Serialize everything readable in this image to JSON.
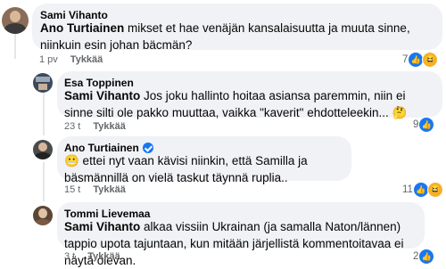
{
  "comments": [
    {
      "author": "Sami Vihanto",
      "mention": "Ano Turtiainen",
      "text": " mikset et hae venäjän kansalaisuutta ja muuta sinne, niinkuin esin johan bäcmän?",
      "time": "1 pv",
      "like_label": "Tykkää",
      "react_count": "7",
      "reactions": [
        "like",
        "haha"
      ],
      "verified": false
    },
    {
      "author": "Esa Toppinen",
      "mention": "Sami Vihanto",
      "text": " Jos joku hallinto hoitaa asiansa paremmin, niin ei sinne silti ole pakko muuttaa, vaikka \"kaverit\" ehdotteleekin... 🤔",
      "time": "23 t",
      "like_label": "Tykkää",
      "react_count": "9",
      "reactions": [
        "like"
      ],
      "verified": false
    },
    {
      "author": "Ano Turtiainen",
      "mention": "",
      "text": "😬 ettei nyt vaan kävisi niinkin, että Samilla ja bäsmännillä on vielä taskut täynnä ruplia..",
      "time": "15 t",
      "like_label": "Tykkää",
      "react_count": "11",
      "reactions": [
        "like",
        "haha"
      ],
      "verified": true
    },
    {
      "author": "Tommi Lievemaa",
      "mention": "Sami Vihanto",
      "text": " alkaa vissiin Ukrainan (ja samalla Naton/lännen) tappio upota tajuntaan, kun mitään järjellistä kommentoitavaa ei näytä olevan.",
      "time": "3 t",
      "like_label": "Tykkää",
      "react_count": "2",
      "reactions": [
        "like"
      ],
      "verified": false
    }
  ],
  "colors": {
    "bubble": "#f0f2f5",
    "meta": "#65676b",
    "like_blue": "#1877f2",
    "haha_yellow": "#f7b125"
  }
}
